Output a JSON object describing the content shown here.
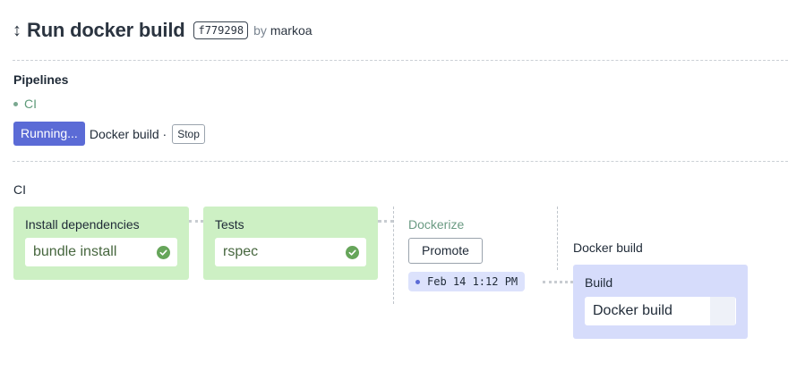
{
  "header": {
    "arrow_icon": "↕",
    "title": "Run docker build",
    "commit": "f779298",
    "by_label": "by",
    "author": "markoa"
  },
  "pipelines": {
    "heading": "Pipelines",
    "items": [
      {
        "label": "CI"
      }
    ],
    "status": {
      "badge": "Running...",
      "text": "Docker build ·",
      "stop_label": "Stop"
    }
  },
  "workflow": {
    "label": "CI",
    "blocks": [
      {
        "title": "Install dependencies",
        "jobs": [
          {
            "name": "bundle install",
            "status": "passed",
            "status_icon": "check-circle-icon"
          }
        ]
      },
      {
        "title": "Tests",
        "jobs": [
          {
            "name": "rspec",
            "status": "passed",
            "status_icon": "check-circle-icon"
          }
        ]
      }
    ],
    "promotion": {
      "title": "Dockerize",
      "promote_label": "Promote",
      "timestamp": "Feb 14 1:12 PM"
    },
    "promoted_pipeline": {
      "label": "Docker build",
      "block": {
        "title": "Build",
        "jobs": [
          {
            "name": "Docker build",
            "status": "running"
          }
        ]
      }
    }
  },
  "colors": {
    "passed_block": "#cdf0c4",
    "running_block": "#d6dcfb",
    "running_badge": "#5b6bd6",
    "passed_check": "#66a55a",
    "link_green": "#5e9a79"
  }
}
